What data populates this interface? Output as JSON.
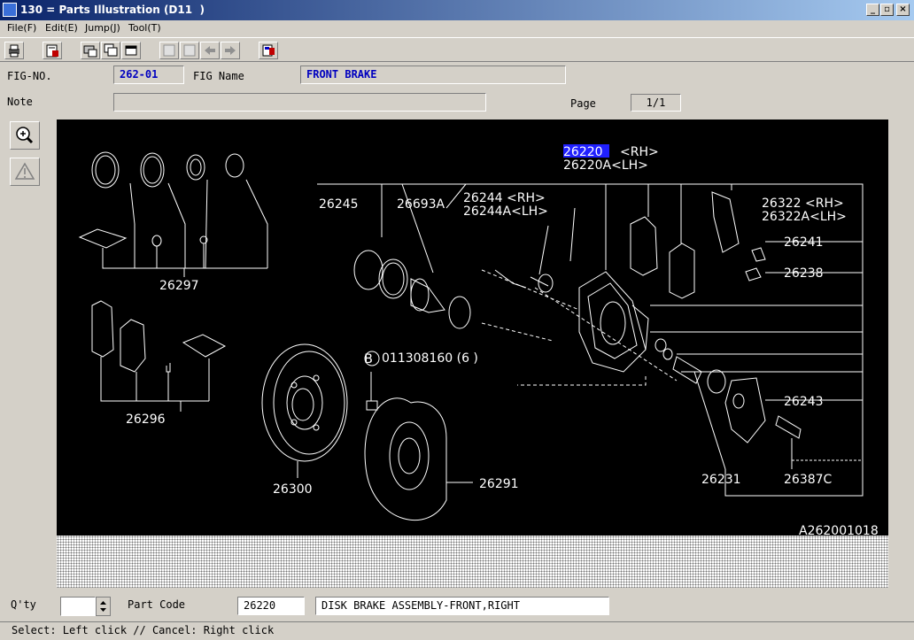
{
  "window": {
    "title": "130 = Parts Illustration (D11  )",
    "min": "_",
    "max": "▫",
    "close": "×"
  },
  "menu": [
    "File(F)",
    "Edit(E)",
    "Jump(J)",
    "Tool(T)"
  ],
  "header": {
    "fig_no_label": "FIG-NO.",
    "fig_no": "262-01",
    "fig_name_label": "FIG Name",
    "fig_name": "FRONT BRAKE",
    "note_label": "Note",
    "note": "",
    "page_label": "Page",
    "page": "1/1"
  },
  "diagram": {
    "labels": {
      "p26220": "26220",
      "p26220_rh": "<RH>",
      "p26220a": "26220A<LH>",
      "p26245": "26245",
      "p26693a": "26693A",
      "p26244": "26244 <RH>",
      "p26244a": "26244A<LH>",
      "p26322": "26322 <RH>",
      "p26322a": "26322A<LH>",
      "p26241": "26241",
      "p26238": "26238",
      "p26297": "26297",
      "p26296": "26296",
      "p011308160": "011308160 (6 )",
      "p26300": "26300",
      "p26291": "26291",
      "p26243": "26243",
      "p26231": "26231",
      "p26387c": "26387C",
      "b_circle": "B",
      "fig_code": "A262001018"
    }
  },
  "footer": {
    "qty_label": "Q'ty",
    "qty": "",
    "part_code_label": "Part Code",
    "part_code": "26220",
    "part_desc": "DISK BRAKE ASSEMBLY-FRONT,RIGHT"
  },
  "status": "Select: Left click // Cancel: Right click"
}
